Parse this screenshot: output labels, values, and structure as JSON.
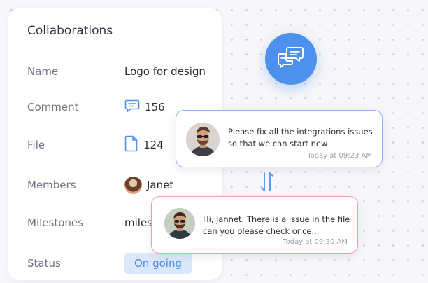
{
  "card": {
    "title": "Collaborations",
    "rows": {
      "name": {
        "label": "Name",
        "value": "Logo for design"
      },
      "comment": {
        "label": "Comment",
        "value": "156"
      },
      "file": {
        "label": "File",
        "value": "124"
      },
      "members": {
        "label": "Members",
        "value": "Janet"
      },
      "milestones": {
        "label": "Milestones",
        "value": "miles"
      },
      "status": {
        "label": "Status",
        "value": "On going"
      }
    }
  },
  "messages": [
    {
      "text": "Please fix all the integrations issues so that we can start new",
      "time": "Today at 09:23 AM"
    },
    {
      "text": "Hi, jannet. There is a issue in the file can you please check once...",
      "time": "Today at 09:30 AM"
    }
  ],
  "colors": {
    "accent": "#4e90ee",
    "message_border_1": "#8db4ef",
    "message_border_2": "#eda0a0",
    "status_bg": "#dbe8fb"
  },
  "icons": {
    "comment": "comment-icon",
    "file": "file-icon",
    "chat": "chat-bubbles-icon",
    "swap": "swap-arrows-icon"
  }
}
